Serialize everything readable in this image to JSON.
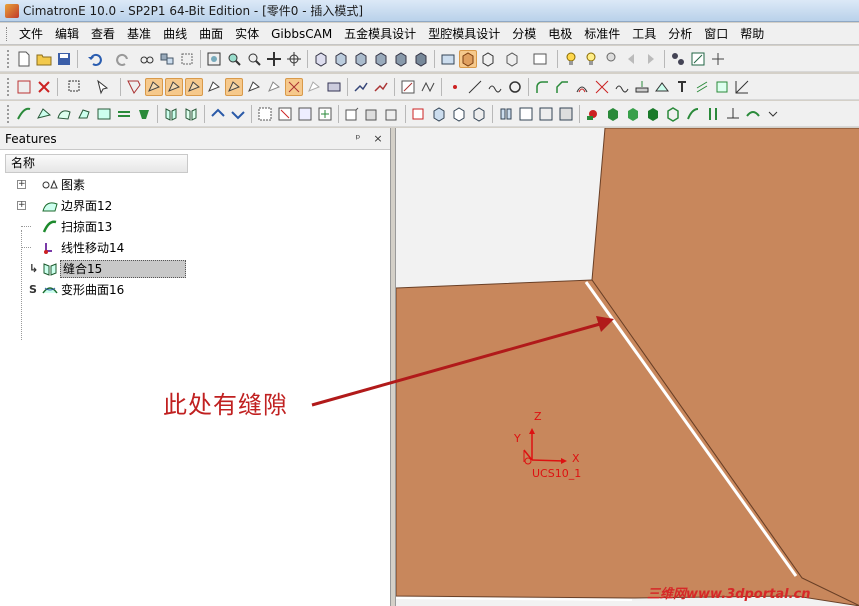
{
  "window": {
    "title": "CimatronE 10.0 - SP2P1 64-Bit Edition - [零件0 - 插入模式]"
  },
  "menu": [
    "文件",
    "编辑",
    "查看",
    "基准",
    "曲线",
    "曲面",
    "实体",
    "GibbsCAM",
    "五金模具设计",
    "型腔模具设计",
    "分模",
    "电极",
    "标准件",
    "工具",
    "分析",
    "窗口",
    "帮助"
  ],
  "features_panel": {
    "title": "Features",
    "pin_glyph": "ᵖ",
    "close_glyph": "×",
    "column_header": "名称",
    "items": [
      {
        "label": "图素",
        "marker": "",
        "expandable": true,
        "icon": "entities-icon"
      },
      {
        "label": "边界面12",
        "marker": "",
        "expandable": true,
        "icon": "boundary-surface-icon"
      },
      {
        "label": "扫掠面13",
        "marker": "",
        "expandable": false,
        "icon": "sweep-surface-icon"
      },
      {
        "label": "线性移动14",
        "marker": "",
        "expandable": false,
        "icon": "linear-move-icon"
      },
      {
        "label": "缝合15",
        "marker": "↳",
        "expandable": false,
        "icon": "stitch-icon",
        "selected": true
      },
      {
        "label": "变形曲面16",
        "marker": "S",
        "expandable": false,
        "icon": "deform-surface-icon"
      }
    ]
  },
  "viewport": {
    "axis_labels": {
      "z": "Z",
      "y": "Y",
      "x": "X"
    },
    "ucs_label": "UCS10_1",
    "surface_color": "#c8875c",
    "background_color": "#f2f2f2"
  },
  "annotation": {
    "text": "此处有缝隙",
    "color": "#c02020"
  },
  "watermark": {
    "text": "三维网www.3dportal.cn"
  }
}
